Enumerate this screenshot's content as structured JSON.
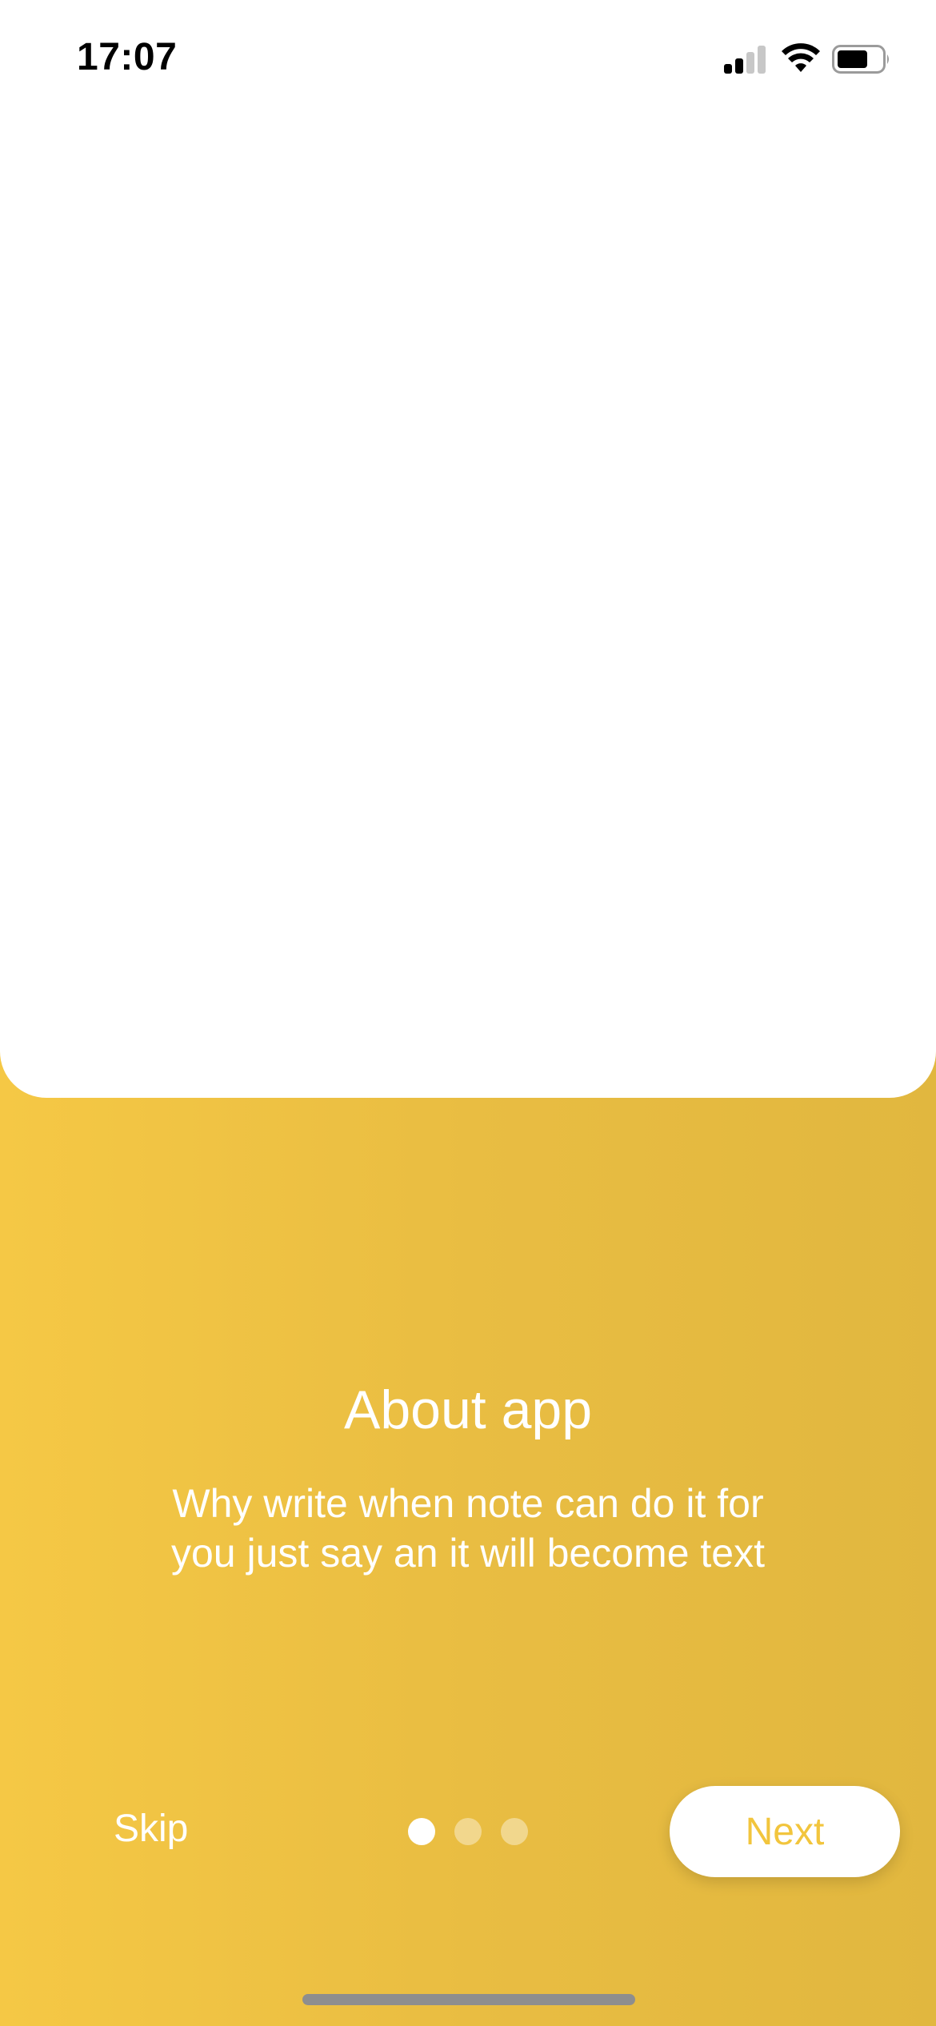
{
  "status_bar": {
    "time": "17:07",
    "signal_icon": "cellular-signal-icon",
    "wifi_icon": "wifi-icon",
    "battery_icon": "battery-icon"
  },
  "illustration_area": {},
  "onboarding": {
    "title": "About app",
    "description": "Why write when note can do it for you just say an it will become text",
    "skip_label": "Skip",
    "next_label": "Next",
    "page_count": 3,
    "current_page": 1
  },
  "colors": {
    "accent": "#F2C53D",
    "background_start": "#F5C845",
    "background_end": "#E1B73F",
    "card": "#FFFFFF"
  }
}
